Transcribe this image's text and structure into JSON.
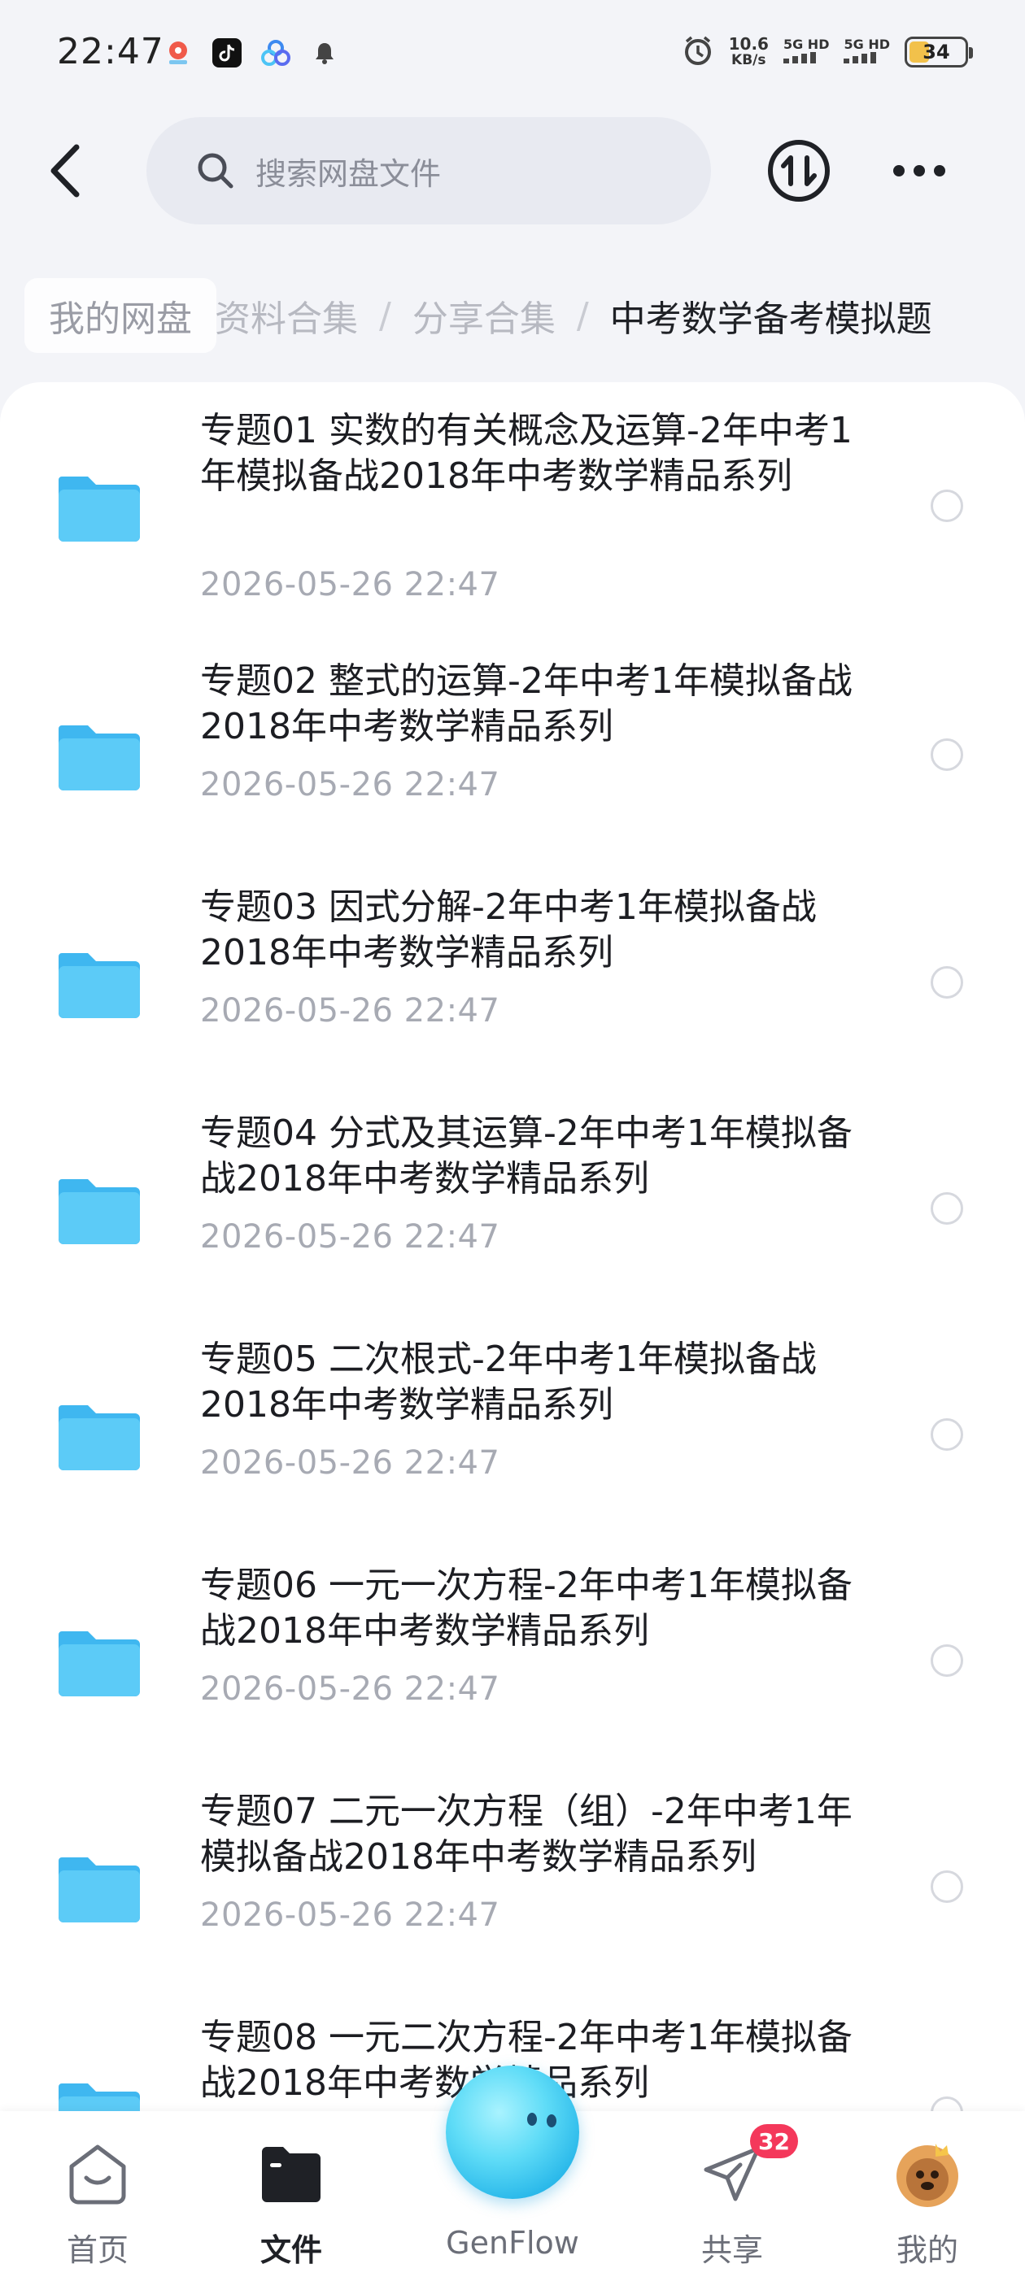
{
  "status_bar": {
    "time": "22:47",
    "speed_value": "10.6",
    "speed_unit": "KB/s",
    "network_1": "5G HD",
    "network_2": "5G HD",
    "battery": "34"
  },
  "header": {
    "search_placeholder": "搜索网盘文件"
  },
  "breadcrumb": {
    "home": "我的网盘",
    "items": [
      "资料合集",
      "分享合集"
    ],
    "current": "中考数学备考模拟题"
  },
  "files": [
    {
      "title": "专题01 实数的有关概念及运算-2年中考1年模拟备战2018年中考数学精品系列",
      "date": "2026-05-26  22:47"
    },
    {
      "title": "专题02 整式的运算-2年中考1年模拟备战2018年中考数学精品系列",
      "date": "2026-05-26  22:47"
    },
    {
      "title": "专题03 因式分解-2年中考1年模拟备战2018年中考数学精品系列",
      "date": "2026-05-26  22:47"
    },
    {
      "title": "专题04 分式及其运算-2年中考1年模拟备战2018年中考数学精品系列",
      "date": "2026-05-26  22:47"
    },
    {
      "title": "专题05 二次根式-2年中考1年模拟备战2018年中考数学精品系列",
      "date": "2026-05-26  22:47"
    },
    {
      "title": "专题06 一元一次方程-2年中考1年模拟备战2018年中考数学精品系列",
      "date": "2026-05-26  22:47"
    },
    {
      "title": "专题07 二元一次方程（组）-2年中考1年模拟备战2018年中考数学精品系列",
      "date": "2026-05-26  22:47"
    },
    {
      "title": "专题08 一元二次方程-2年中考1年模拟备战2018年中考数学精品系列",
      "date": ""
    }
  ],
  "bottom_nav": {
    "home": "首页",
    "files": "文件",
    "genflow": "GenFlow",
    "share": "共享",
    "share_badge": "32",
    "mine": "我的"
  },
  "colors": {
    "folder_blue": "#4cc4f6",
    "badge_red": "#f4385b",
    "accent": "#2bb9ea"
  }
}
